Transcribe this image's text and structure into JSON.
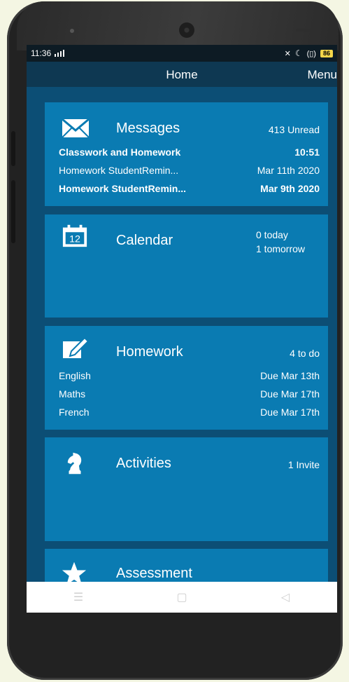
{
  "status": {
    "time": "11:36",
    "battery": "86"
  },
  "appbar": {
    "title": "Home",
    "menu_label": "Menu"
  },
  "cards": {
    "messages": {
      "title": "Messages",
      "summary": "413 Unread",
      "rows": [
        {
          "subject": "Classwork and Homework",
          "date": "10:51",
          "unread": true
        },
        {
          "subject": "Homework StudentRemin...",
          "date": "Mar 11th 2020",
          "unread": false
        },
        {
          "subject": "Homework StudentRemin...",
          "date": "Mar 9th 2020",
          "unread": true
        }
      ]
    },
    "calendar": {
      "title": "Calendar",
      "icon_day": "12",
      "summary_today": "0 today",
      "summary_tomorrow": "1 tomorrow"
    },
    "homework": {
      "title": "Homework",
      "summary": "4 to do",
      "rows": [
        {
          "subject": "English",
          "due": "Due Mar 13th"
        },
        {
          "subject": "Maths",
          "due": "Due Mar 17th"
        },
        {
          "subject": "French",
          "due": "Due Mar 17th"
        }
      ]
    },
    "activities": {
      "title": "Activities",
      "summary": "1 Invite"
    },
    "assessment": {
      "title": "Assessment"
    }
  },
  "icons": {
    "messages": "envelope-icon",
    "calendar": "calendar-icon",
    "homework": "pencil-edit-icon",
    "activities": "chess-knight-icon",
    "assessment": "star-icon"
  },
  "colors": {
    "background": "#0c4e75",
    "card": "#0a7bb2",
    "appbar": "#0e3852",
    "statusbar": "#0d1b24"
  }
}
